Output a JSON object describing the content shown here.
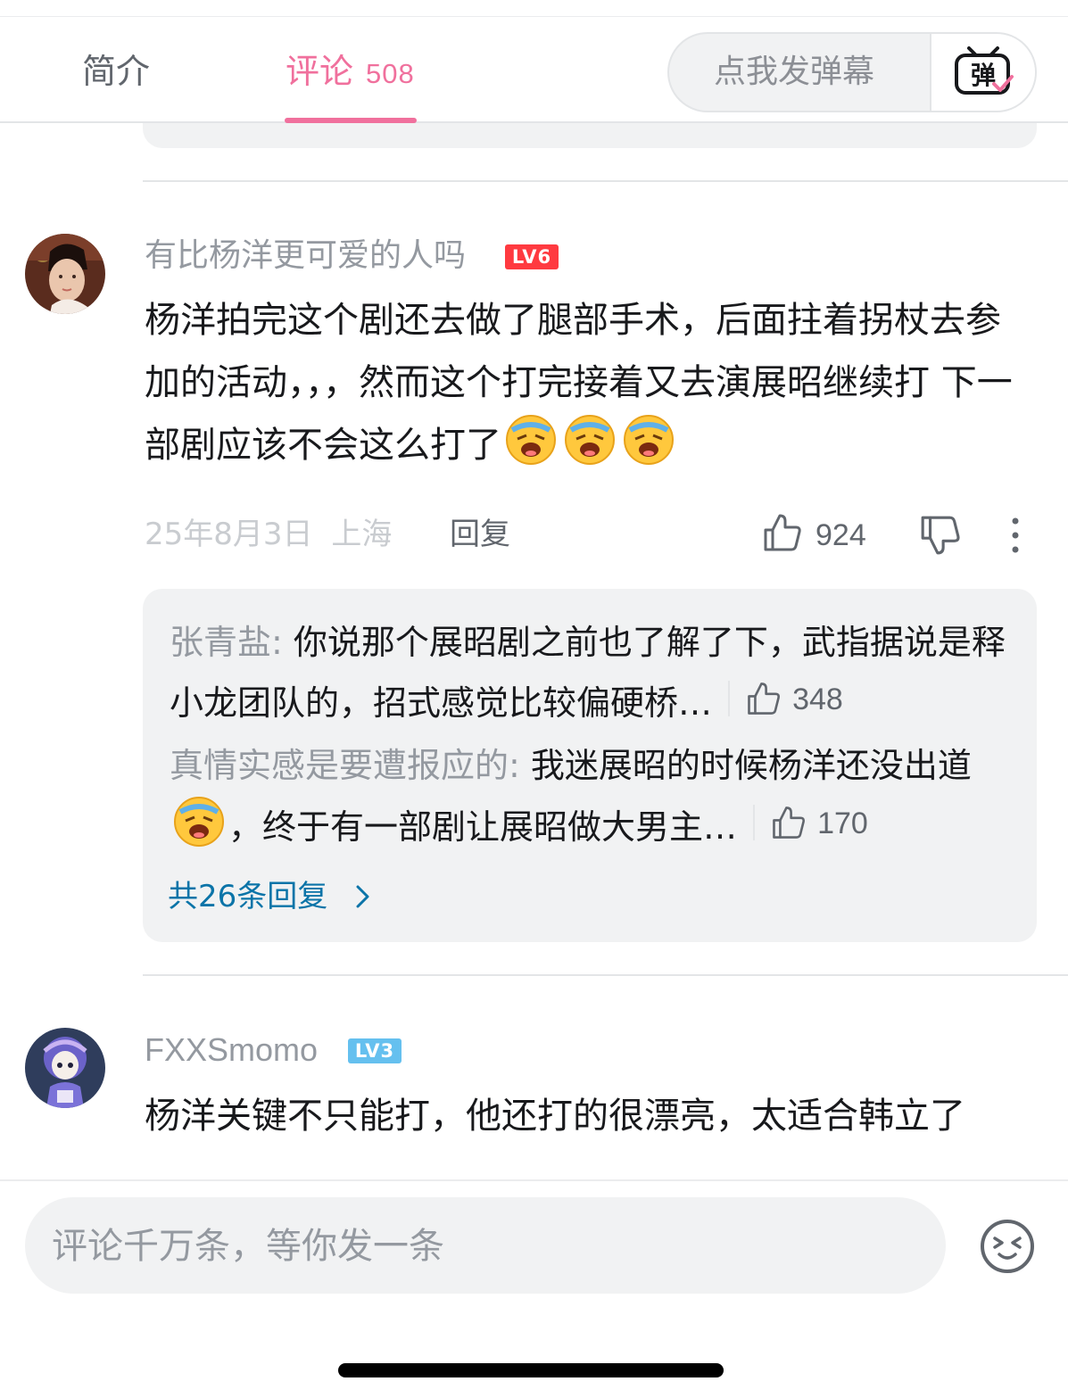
{
  "tabs": {
    "intro_label": "简介",
    "comments_label": "评论",
    "comments_count": "508",
    "danmaku_placeholder": "点我发弹幕",
    "danmaku_button_label": "弹"
  },
  "comments": [
    {
      "username": "有比杨洋更可爱的人吗",
      "level": "LV6",
      "text": "杨洋拍完这个剧还去做了腿部手术，后面拄着拐杖去参加的活动，，，然而这个打完接着又去演展昭继续打 下一部剧应该不会这么打了",
      "date": "25年8月3日",
      "location": "上海",
      "reply_label": "回复",
      "likes": "924",
      "replies": [
        {
          "user": "张青盐",
          "text": "你说那个展昭剧之前也了解了下，武指据说是释小龙团队的，招式感觉比较偏硬桥…",
          "likes": "348"
        },
        {
          "user": "真情实感是要遭报应的",
          "text_before_emoji": "我迷展昭的时候杨洋还没出道",
          "text_after_emoji": "，终于有一部剧让展昭做大男主…",
          "likes": "170"
        }
      ],
      "more_replies_label": "共26条回复"
    },
    {
      "username": "FXXSmomo",
      "level": "LV3",
      "text": "杨洋关键不只能打，他还打的很漂亮，太适合韩立了"
    }
  ],
  "bottom": {
    "input_placeholder": "评论千万条，等你发一条"
  },
  "colors": {
    "accent_pink": "#f0709d",
    "link_blue": "#0b74a8",
    "level6": "#ff3a40",
    "level3": "#65c0ef"
  }
}
